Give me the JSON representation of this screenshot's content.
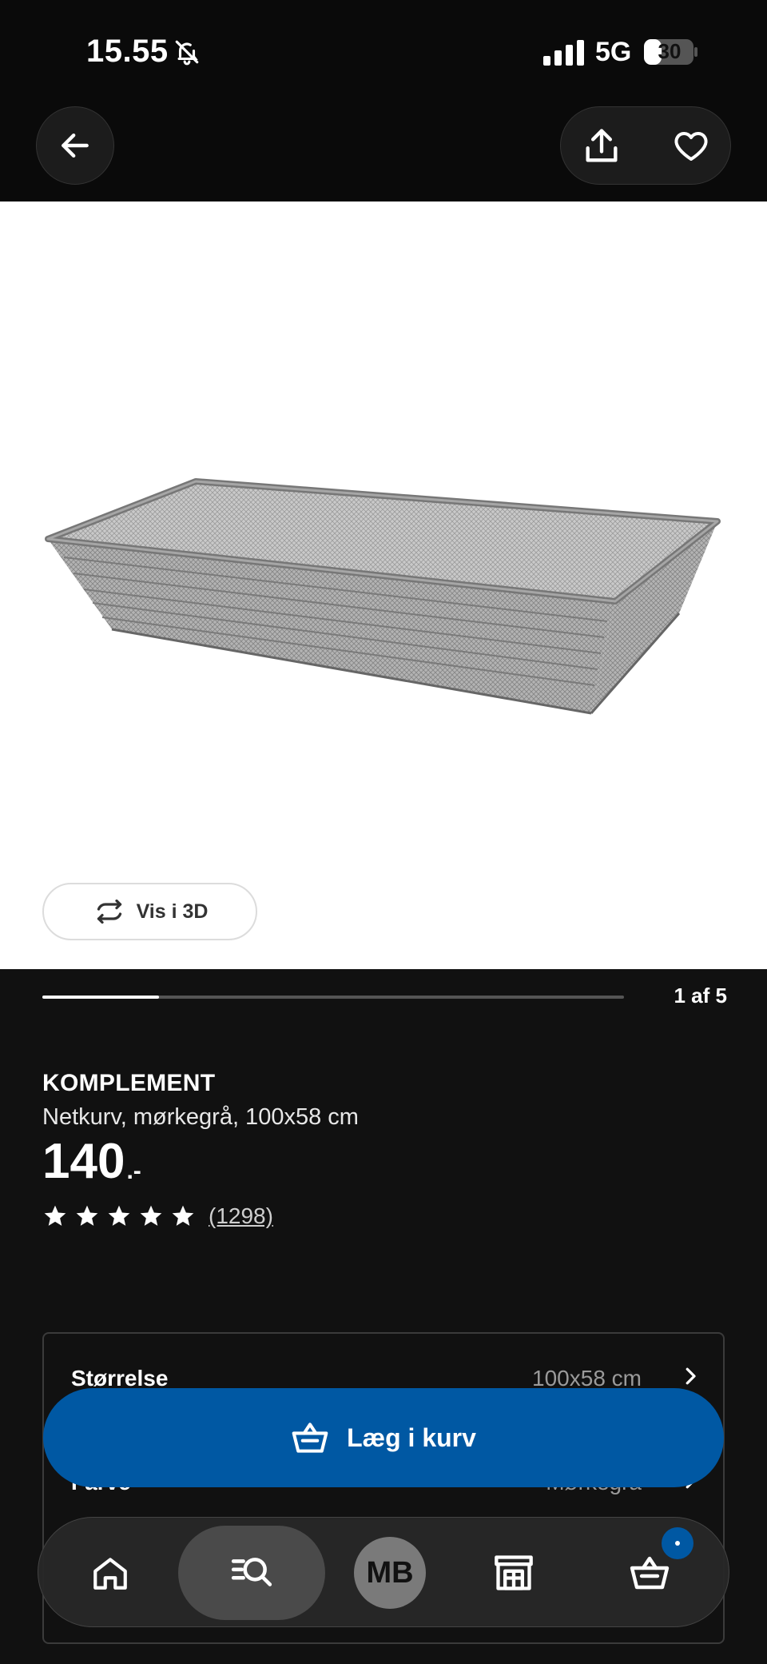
{
  "status_bar": {
    "time": "15.55",
    "network": "5G",
    "battery": "30",
    "icons": [
      "bell-muted-icon",
      "signal-icon",
      "battery-icon"
    ]
  },
  "top_nav": {
    "icons": [
      "arrow-left-icon",
      "share-icon",
      "heart-icon"
    ]
  },
  "image": {
    "view_3d_label": "Vis i 3D",
    "view_3d_icon": "rotate-icon"
  },
  "carousel": {
    "counter": "1 af 5",
    "progress": 0.2
  },
  "product": {
    "brand": "KOMPLEMENT",
    "description": "Netkurv, mørkegrå, 100x58 cm",
    "price": "140",
    "price_suffix": ".-",
    "rating": 5,
    "review_count": "(1298)"
  },
  "options": [
    {
      "label": "Størrelse",
      "value": "100x58 cm"
    },
    {
      "label": "Farve",
      "value": "Mørkegrå"
    }
  ],
  "add_to_basket": {
    "label": "Læg i kurv",
    "color": "#0058a3"
  },
  "bottom_nav": {
    "avatar_initials": "MB",
    "items": [
      "home-icon",
      "search-icon",
      "profile-avatar",
      "store-icon",
      "basket-icon"
    ],
    "active": "search-icon",
    "badge_color": "#0058a3"
  }
}
